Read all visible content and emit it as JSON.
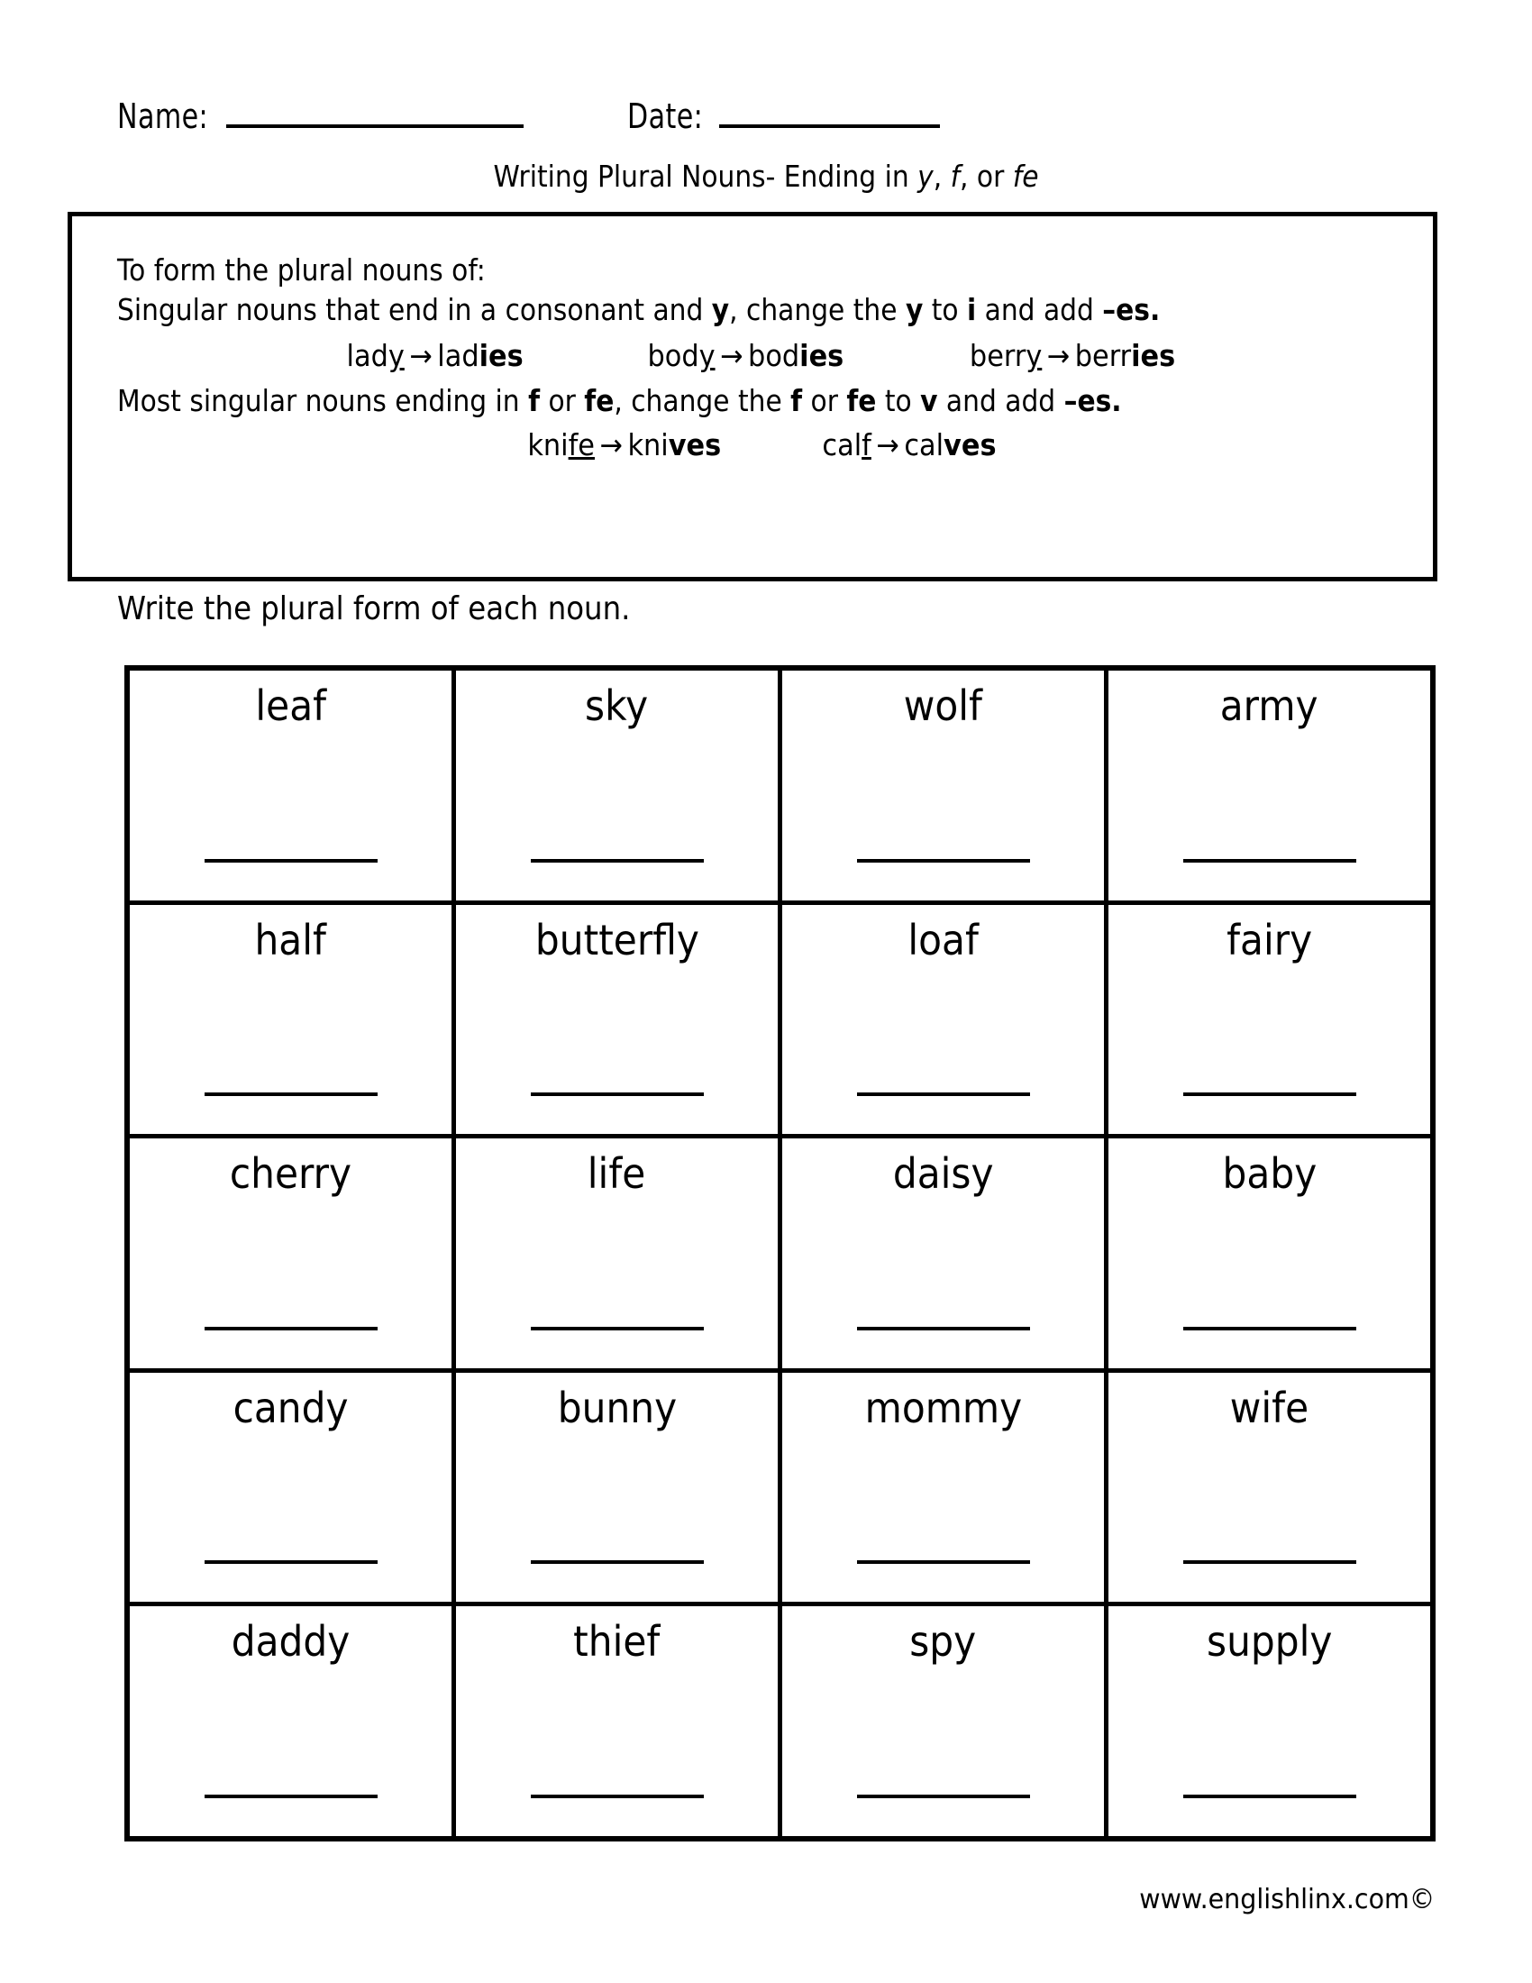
{
  "header": {
    "name_label": "Name:",
    "date_label": "Date:"
  },
  "title": {
    "prefix": "Writing Plural Nouns- Ending in ",
    "italic_y": "y",
    "sep1": ", ",
    "italic_f": "f",
    "sep2": ", or ",
    "italic_fe": "fe"
  },
  "rules": {
    "line1": "To form the plural nouns of:",
    "line2_a": " Singular nouns that end in a consonant and ",
    "line2_y1": "y",
    "line2_b": ", change the ",
    "line2_y2": "y",
    "line2_c": " to ",
    "line2_i": "i",
    "line2_d": " and add ",
    "line2_es": "–es.",
    "examples_y": [
      {
        "singular_stem": "lad",
        "singular_end": "y",
        "plural_stem": "lad",
        "plural_end": "ies"
      },
      {
        "singular_stem": "bod",
        "singular_end": "y",
        "plural_stem": "bod",
        "plural_end": "ies"
      },
      {
        "singular_stem": "berr",
        "singular_end": "y",
        "plural_stem": "berr",
        "plural_end": "ies"
      }
    ],
    "line3_a": "Most singular nouns ending in ",
    "line3_f1": "f",
    "line3_b": " or ",
    "line3_fe1": "fe",
    "line3_c": ", change the ",
    "line3_f2": "f",
    "line3_d": " or ",
    "line3_fe2": "fe",
    "line3_e": " to ",
    "line3_v": "v",
    "line3_g": " and add ",
    "line3_es": "–es.",
    "examples_f": [
      {
        "singular_stem": "kni",
        "singular_end": "fe",
        "plural_stem": "kni",
        "plural_end": "ves"
      },
      {
        "singular_stem": "cal",
        "singular_end": "f",
        "plural_stem": "cal",
        "plural_end": "ves"
      }
    ],
    "arrow": "→"
  },
  "directions": "Write the plural form of each noun.",
  "grid": {
    "rows": [
      [
        "leaf",
        "sky",
        "wolf",
        "army"
      ],
      [
        "half",
        "butterfly",
        "loaf",
        "fairy"
      ],
      [
        "cherry",
        "life",
        "daisy",
        "baby"
      ],
      [
        "candy",
        "bunny",
        "mommy",
        "wife"
      ],
      [
        "daddy",
        "thief",
        "spy",
        "supply"
      ]
    ]
  },
  "footer": {
    "credit": "www.englishlinx.com©"
  },
  "colors": {
    "ink": "#000000",
    "paper": "#ffffff"
  }
}
